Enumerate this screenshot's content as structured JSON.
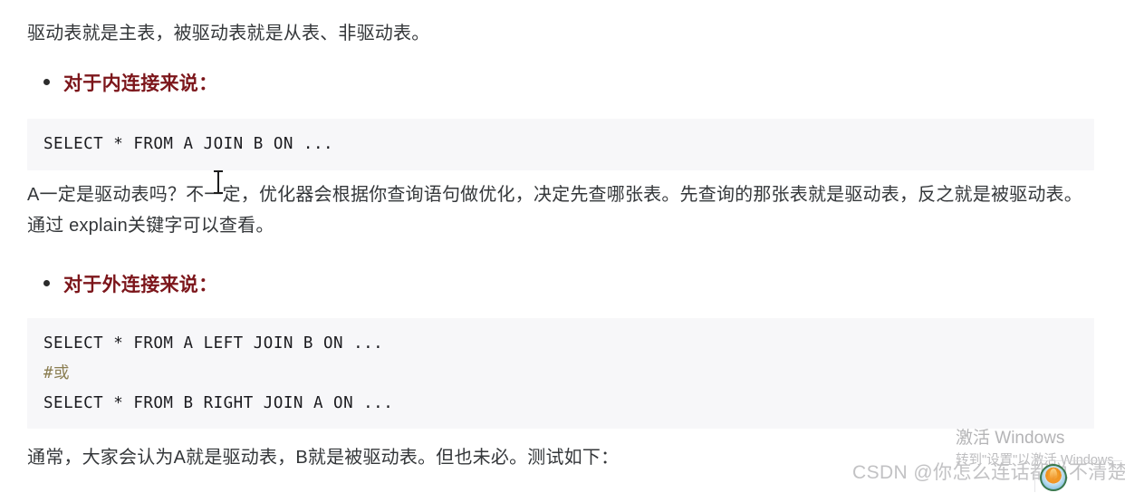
{
  "document": {
    "intro_paragraph": "驱动表就是主表，被驱动表就是从表、非驱动表。",
    "sections": [
      {
        "heading": "对于内连接来说：",
        "code_lines": [
          {
            "text": "SELECT * FROM A JOIN B ON ...",
            "type": "sql"
          }
        ]
      },
      {
        "heading": "对于外连接来说：",
        "code_lines": [
          {
            "text": "SELECT * FROM A LEFT JOIN B ON ...",
            "type": "sql"
          },
          {
            "text": "#或",
            "type": "comment"
          },
          {
            "text": "SELECT * FROM B RIGHT JOIN A ON ...",
            "type": "sql"
          }
        ]
      }
    ],
    "middle_paragraph": "A一定是驱动表吗？不一定，优化器会根据你查询语句做优化，决定先查哪张表。先查询的那张表就是驱动表，反之就是被驱动表。通过 explain关键字可以查看。",
    "bottom_paragraph": "通常，大家会认为A就是驱动表，B就是被驱动表。但也未必。测试如下：",
    "code_line_1": "SELECT * FROM A JOIN B ON ...",
    "code_line_2a": "SELECT * FROM A LEFT JOIN B ON ...",
    "code_line_2b": "#或",
    "code_line_2c": "SELECT * FROM B RIGHT JOIN A ON ..."
  },
  "watermarks": {
    "windows_title": "激活 Windows",
    "windows_subtitle": "转到\"设置\"以激活 Windows",
    "csdn": "CSDN @你怎么连话都说不清楚"
  },
  "colors": {
    "heading_red": "#7c161b",
    "code_background": "#f7f7f9",
    "code_text": "#1b1b1f",
    "comment_text": "#8b7e52",
    "body_text": "#34373a",
    "watermark_gray": "#bdbdbf"
  }
}
